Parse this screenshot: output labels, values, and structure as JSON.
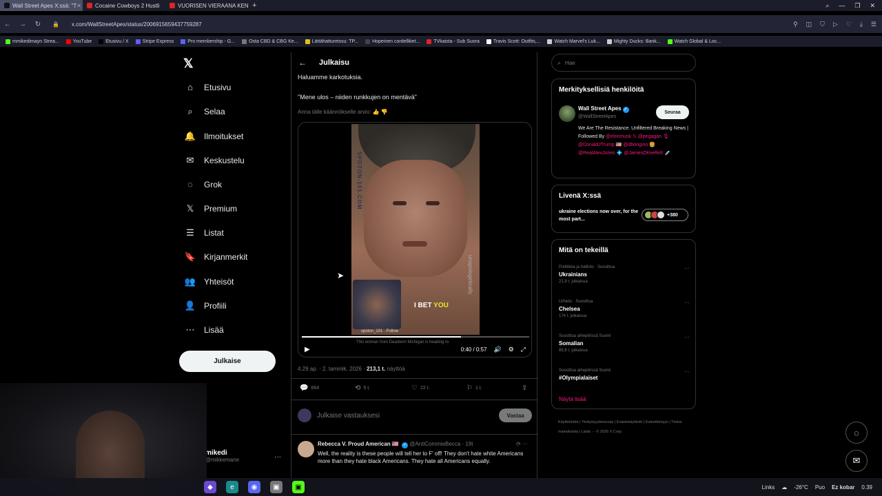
{
  "browser": {
    "tabs": [
      {
        "label": "Wall Street Apes X:ssä: \"T",
        "color": "#111111",
        "active": true
      },
      {
        "label": "Cocaine Cowboys 2 Hustli",
        "color": "#e02424",
        "active": false
      },
      {
        "label": "VUORISEN VIERAANA KEN",
        "color": "#e02424",
        "active": false
      }
    ],
    "url": "x.com/WallStreetApes/status/2006915659437759287",
    "bookmarks": [
      {
        "label": "mmikedimayn Strea...",
        "color": "#53fc18"
      },
      {
        "label": "YouTube",
        "color": "#ff0000"
      },
      {
        "label": "Etusivu / X",
        "color": "#000000"
      },
      {
        "label": "Stripe Express",
        "color": "#635bff"
      },
      {
        "label": "Pro membership - G...",
        "color": "#5865f2"
      },
      {
        "label": "Osta CBD & CBG Ke...",
        "color": "#777777"
      },
      {
        "label": "Lättähattureissu: TP...",
        "color": "#e0c020"
      },
      {
        "label": "Hopeinen cordelliket...",
        "color": "#444444"
      },
      {
        "label": "TVkaista - Sub Suora",
        "color": "#e02424"
      },
      {
        "label": "Travis Scott: Outfits,...",
        "color": "#ffffff"
      },
      {
        "label": "Watch Marvel's Luk...",
        "color": "#cccccc"
      },
      {
        "label": "Mighty Ducks: Bank...",
        "color": "#cccccc"
      },
      {
        "label": "Watch Global & Loc...",
        "color": "#53fc18"
      }
    ]
  },
  "nav": {
    "items": [
      {
        "label": "Etusivu",
        "icon": "⌂",
        "name": "home"
      },
      {
        "label": "Selaa",
        "icon": "⌕",
        "name": "explore"
      },
      {
        "label": "Ilmoitukset",
        "icon": "🔔",
        "name": "notifications"
      },
      {
        "label": "Keskustelu",
        "icon": "✉",
        "name": "messages"
      },
      {
        "label": "Grok",
        "icon": "◌",
        "name": "grok"
      },
      {
        "label": "Premium",
        "icon": "𝕏",
        "name": "premium"
      },
      {
        "label": "Listat",
        "icon": "☰",
        "name": "lists"
      },
      {
        "label": "Kirjanmerkit",
        "icon": "🔖",
        "name": "bookmarks"
      },
      {
        "label": "Yhteisöt",
        "icon": "👥",
        "name": "communities"
      },
      {
        "label": "Profiili",
        "icon": "👤",
        "name": "profile"
      },
      {
        "label": "Lisää",
        "icon": "⋯",
        "name": "more"
      }
    ],
    "post_label": "Julkaise",
    "account_name": "mikedi",
    "account_handle": "@mikkemane"
  },
  "post": {
    "header_title": "Julkaisu",
    "line1": "Haluamme karkotuksia.",
    "line2": "\"Mene ulos – niiden runkkujen on mentävä\"",
    "rate_translation": "Anna tälle käännökselle arvio:",
    "video": {
      "side_text": "SPOTON-101.COM",
      "side_text2": "unapologetically",
      "caption_main": "I BET",
      "caption_highlight": "YOU",
      "account": "spoton_101 · Follow",
      "subtext": "This woman from Dearborn Michigan is heading to",
      "time": "0:40 / 0:57",
      "progress": 0.7
    },
    "meta_time": "4.29 ap. · 2. tammik. 2026 ·",
    "meta_views": "213,1 t.",
    "meta_views_label": "näyttöä",
    "actions": {
      "replies": "664",
      "reposts": "5 t.",
      "likes": "22 t.",
      "bookmarks": "1 t."
    },
    "reply_placeholder": "Julkaise vastauksesi",
    "reply_button": "Vastaa"
  },
  "comment": {
    "name": "Rebecca V. Proud American 🇺🇸",
    "handle": "@AntiCommieBecca · 19t",
    "text": "Well, the reality is these people will tell her to F' off! They don't hate white Americans more than they hate black Americans. They hate all Americans equally."
  },
  "right": {
    "search_placeholder": "Hae",
    "relevant_title": "Merkityksellisiä henkilöitä",
    "wsa_name": "Wall Street Apes",
    "wsa_handle": "@WallStreetApes",
    "follow_label": "Seuraa",
    "bio_plain": "We Are The Resistance. Unfiltered Breaking News | Followed By",
    "bio_mentions": "@elonmusk 𝕏 @pegagan 🎙 @DonaldJTrump 🇺🇸 @dbongino 🍔 @RealAlexJones 💠 @JamesOKeefeIII 💉",
    "live_title": "Livenä X:ssä",
    "live_text": "ukraine elections now over, for the most part...",
    "live_count": "+380",
    "trends_title": "Mitä on tekeillä",
    "trends": [
      {
        "category": "Politiikka ja hallinto · Suosittua",
        "name": "Ukrainians",
        "posts": "21,9 t. julkaisua"
      },
      {
        "category": "Urheilu · Suosittua",
        "name": "Chelsea",
        "posts": "174 t. julkaisua"
      },
      {
        "category": "Suosittua aihepiirissä Suomi",
        "name": "Somalian",
        "posts": "85,6 t. julkaisua"
      },
      {
        "category": "Suosittua aihepiirissä Suomi",
        "name": "#Olympialaiset",
        "posts": ""
      }
    ],
    "show_more": "Näytä lisää",
    "footer": "Käyttöehdot | Yksityisyydensuoja | Evästekäytäntö | Esteettömyys | Tietoa mainoksista | Lisää ··· © 2026 X Corp."
  },
  "taskbar": {
    "links": "Links",
    "weather": "-26°C",
    "weather_label": "Puo",
    "user": "Ez kobar",
    "time": "0.39"
  }
}
